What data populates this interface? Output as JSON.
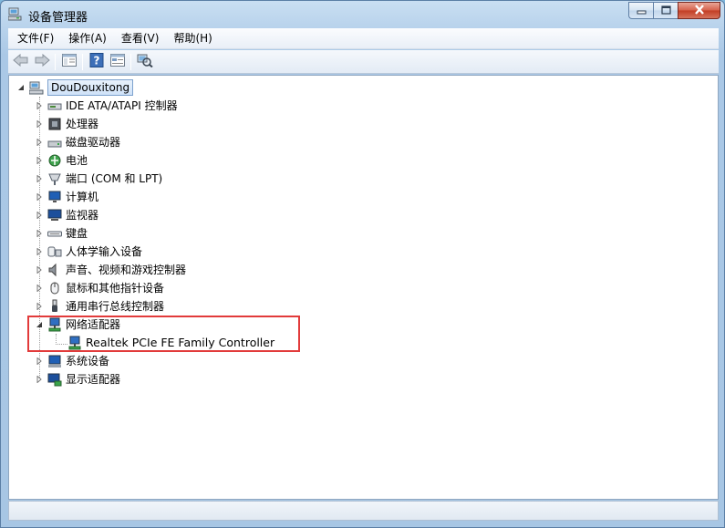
{
  "window": {
    "title": "设备管理器"
  },
  "menu": [
    {
      "label": "文件(F)"
    },
    {
      "label": "操作(A)"
    },
    {
      "label": "查看(V)"
    },
    {
      "label": "帮助(H)"
    }
  ],
  "tree": {
    "root": "DouDouxitong",
    "categories": [
      {
        "label": "IDE ATA/ATAPI 控制器",
        "icon": "ide-controller-icon",
        "expanded": false
      },
      {
        "label": "处理器",
        "icon": "processor-icon",
        "expanded": false
      },
      {
        "label": "磁盘驱动器",
        "icon": "disk-drive-icon",
        "expanded": false
      },
      {
        "label": "电池",
        "icon": "battery-icon",
        "expanded": false
      },
      {
        "label": "端口 (COM 和 LPT)",
        "icon": "port-icon",
        "expanded": false
      },
      {
        "label": "计算机",
        "icon": "computer-icon",
        "expanded": false
      },
      {
        "label": "监视器",
        "icon": "monitor-icon",
        "expanded": false
      },
      {
        "label": "键盘",
        "icon": "keyboard-icon",
        "expanded": false
      },
      {
        "label": "人体学输入设备",
        "icon": "hid-icon",
        "expanded": false
      },
      {
        "label": "声音、视频和游戏控制器",
        "icon": "sound-icon",
        "expanded": false
      },
      {
        "label": "鼠标和其他指针设备",
        "icon": "mouse-icon",
        "expanded": false
      },
      {
        "label": "通用串行总线控制器",
        "icon": "usb-icon",
        "expanded": false
      },
      {
        "label": "网络适配器",
        "icon": "network-adapter-icon",
        "expanded": true,
        "children": [
          {
            "label": "Realtek PCIe FE Family Controller",
            "icon": "network-card-icon"
          }
        ]
      },
      {
        "label": "系统设备",
        "icon": "system-device-icon",
        "expanded": false
      },
      {
        "label": "显示适配器",
        "icon": "display-adapter-icon",
        "expanded": false
      }
    ]
  },
  "colors": {
    "highlight": "#e23b3b",
    "selection": "#cfe2f8",
    "title_bar": "#b9d3ec"
  }
}
